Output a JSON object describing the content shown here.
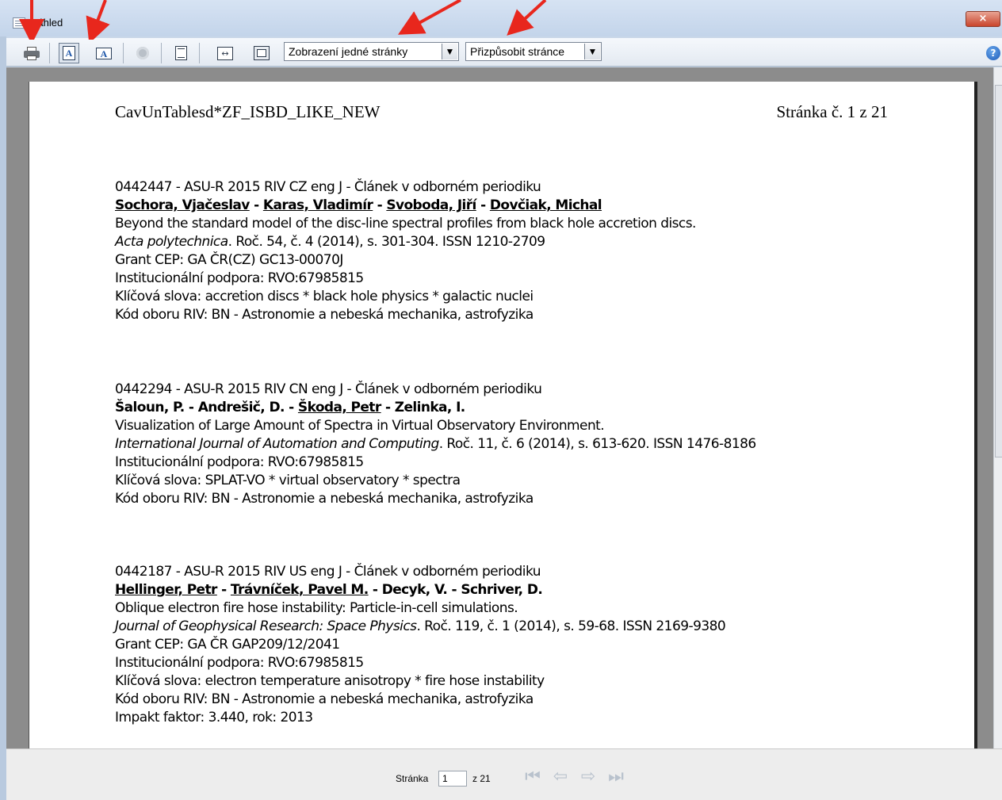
{
  "window": {
    "title": "Náhled",
    "close_label": "×"
  },
  "toolbar": {
    "view_mode": "Zobrazení jedné stránky",
    "zoom_mode": "Přizpůsobit stránce"
  },
  "document": {
    "header_left": "CavUnTablesd*ZF_ISBD_LIKE_NEW",
    "header_right": "Stránka č. 1 z 21",
    "records": [
      {
        "id_line": "0442447 - ASU-R 2015 RIV CZ eng J - Článek v odborném periodiku",
        "authors": [
          {
            "name": "Sochora, Vjačeslav",
            "underlined": true
          },
          {
            "name": "Karas, Vladimír",
            "underlined": true
          },
          {
            "name": "Svoboda, Jiří",
            "underlined": true
          },
          {
            "name": "Dovčiak, Michal",
            "underlined": true
          }
        ],
        "title": "Beyond the standard model of the disc-line spectral profiles from black hole accretion discs.",
        "journal": "Acta polytechnica",
        "journal_rest": ". Roč. 54, č. 4 (2014), s. 301-304. ISSN 1210-2709",
        "extra": [
          "Grant CEP: GA ČR(CZ) GC13-00070J",
          "Institucionální podpora: RVO:67985815",
          "Klíčová slova: accretion discs * black hole physics * galactic nuclei",
          "Kód oboru RIV: BN - Astronomie a nebeská mechanika, astrofyzika"
        ]
      },
      {
        "id_line": "0442294 - ASU-R 2015 RIV CN eng J - Článek v odborném periodiku",
        "authors": [
          {
            "name": "Šaloun, P.",
            "underlined": false
          },
          {
            "name": "Andrešič, D.",
            "underlined": false
          },
          {
            "name": "Škoda, Petr",
            "underlined": true
          },
          {
            "name": "Zelinka, I.",
            "underlined": false
          }
        ],
        "title": "Visualization of Large Amount of Spectra in Virtual Observatory Environment.",
        "journal": "International Journal of Automation and Computing",
        "journal_rest": ". Roč. 11, č. 6 (2014), s. 613-620. ISSN 1476-8186",
        "extra": [
          "Institucionální podpora: RVO:67985815",
          "Klíčová slova: SPLAT-VO * virtual observatory * spectra",
          "Kód oboru RIV: BN - Astronomie a nebeská mechanika, astrofyzika"
        ]
      },
      {
        "id_line": "0442187 - ASU-R 2015 RIV US eng J - Článek v odborném periodiku",
        "authors": [
          {
            "name": "Hellinger, Petr",
            "underlined": true
          },
          {
            "name": "Trávníček, Pavel M.",
            "underlined": true
          },
          {
            "name": "Decyk, V.",
            "underlined": false
          },
          {
            "name": "Schriver, D.",
            "underlined": false
          }
        ],
        "title": "Oblique electron fire hose instability: Particle-in-cell simulations.",
        "journal": "Journal of Geophysical Research: Space Physics",
        "journal_rest": ". Roč. 119, č. 1 (2014), s. 59-68. ISSN 2169-9380",
        "extra": [
          "Grant CEP: GA ČR GAP209/12/2041",
          "Institucionální podpora: RVO:67985815",
          "Klíčová slova: electron temperature anisotropy * fire hose instability",
          "Kód oboru RIV: BN - Astronomie a nebeská mechanika, astrofyzika",
          "Impakt faktor: 3.440, rok: 2013"
        ]
      }
    ]
  },
  "footer": {
    "page_label": "Stránka",
    "current_page": "1",
    "total_label": "z 21"
  },
  "colors": {
    "annotation_arrow": "#e8271d",
    "title_bar": "#c3d4ea"
  },
  "icons": [
    "print-icon",
    "portrait-icon",
    "landscape-icon",
    "settings-gear-icon",
    "single-page-icon",
    "fit-width-icon",
    "fit-page-icon",
    "help-icon",
    "first-page-icon",
    "prev-page-icon",
    "next-page-icon",
    "last-page-icon"
  ]
}
